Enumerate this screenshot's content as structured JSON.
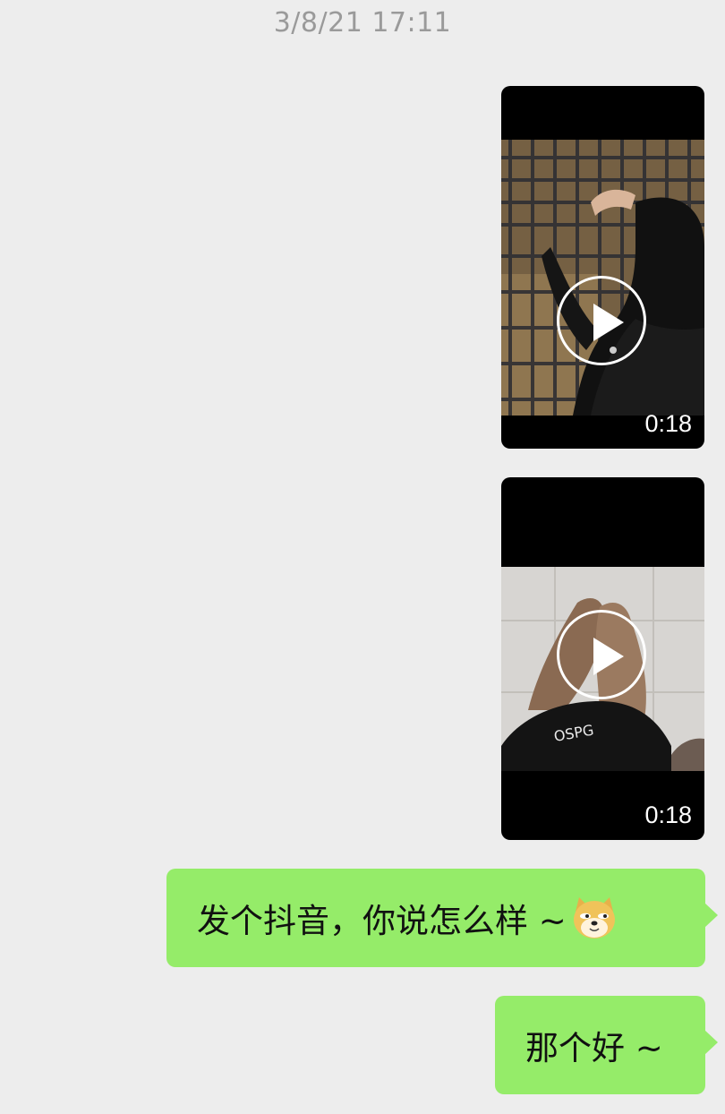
{
  "chat": {
    "timestamp": "3/8/21 17:11",
    "messages": [
      {
        "type": "video",
        "duration": "0:18"
      },
      {
        "type": "video",
        "duration": "0:18"
      },
      {
        "type": "text",
        "text": "发个抖音，你说怎么样 ~",
        "emoji": "doge-emoji"
      },
      {
        "type": "text",
        "text": "那个好 ~"
      }
    ]
  },
  "colors": {
    "background": "#ededed",
    "bubble": "#95ec69",
    "timestamp": "#9a9a9a"
  }
}
